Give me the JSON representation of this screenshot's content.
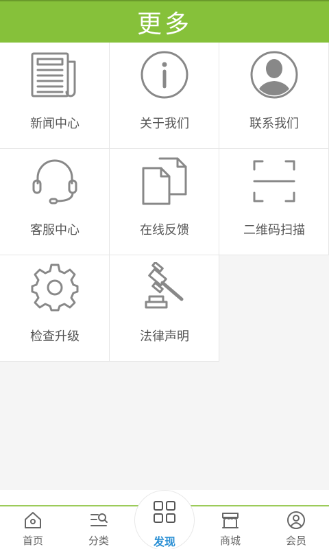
{
  "header": {
    "title": "更多"
  },
  "grid": {
    "items": [
      {
        "label": "新闻中心",
        "icon": "newspaper-icon"
      },
      {
        "label": "关于我们",
        "icon": "info-icon"
      },
      {
        "label": "联系我们",
        "icon": "person-avatar-icon"
      },
      {
        "label": "客服中心",
        "icon": "headset-icon"
      },
      {
        "label": "在线反馈",
        "icon": "documents-icon"
      },
      {
        "label": "二维码扫描",
        "icon": "scan-frame-icon"
      },
      {
        "label": "检查升级",
        "icon": "gear-icon"
      },
      {
        "label": "法律声明",
        "icon": "gavel-icon"
      }
    ]
  },
  "tabbar": {
    "active": "发现",
    "tabs": [
      {
        "label": "首页",
        "icon": "home-icon"
      },
      {
        "label": "分类",
        "icon": "category-search-icon"
      },
      {
        "label": "发现",
        "icon": "grid-icon"
      },
      {
        "label": "商城",
        "icon": "store-icon"
      },
      {
        "label": "会员",
        "icon": "user-icon"
      }
    ]
  },
  "colors": {
    "header": "#86c13a",
    "active_tab": "#2a8fd4",
    "icon_gray": "#888888"
  }
}
